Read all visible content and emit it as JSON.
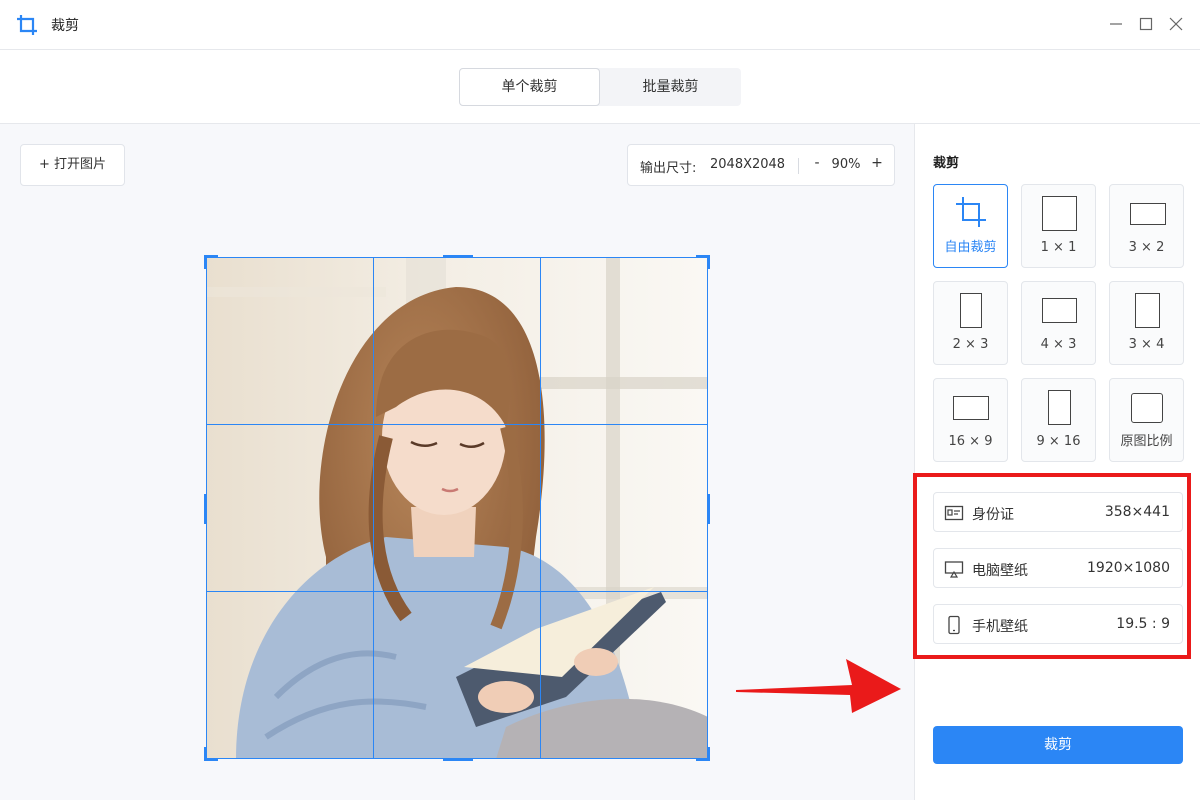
{
  "app": {
    "title": "裁剪",
    "icon": "crop-icon"
  },
  "window_controls": {
    "minimize": "minimize-icon",
    "maximize": "maximize-icon",
    "close": "close-icon"
  },
  "mode_tabs": [
    {
      "label": "单个裁剪",
      "active": true
    },
    {
      "label": "批量裁剪",
      "active": false
    }
  ],
  "toolbar": {
    "open_label": "+ 打开图片",
    "output_label": "输出尺寸:",
    "output_value": "2048X2048",
    "zoom_minus": "-",
    "zoom_value": "90%",
    "zoom_plus": "+"
  },
  "panel": {
    "title": "裁剪",
    "ratios": [
      {
        "label": "自由裁剪",
        "selected": true,
        "icon": "free-crop-icon"
      },
      {
        "label": "1 × 1",
        "selected": false
      },
      {
        "label": "3 × 2",
        "selected": false
      },
      {
        "label": "2 × 3",
        "selected": false
      },
      {
        "label": "4 × 3",
        "selected": false
      },
      {
        "label": "3 × 4",
        "selected": false
      },
      {
        "label": "16 × 9",
        "selected": false
      },
      {
        "label": "9 × 16",
        "selected": false
      },
      {
        "label": "原图比例",
        "selected": false
      }
    ],
    "presets": [
      {
        "name": "身份证",
        "value": "358×441",
        "icon": "id-card-icon"
      },
      {
        "name": "电脑壁纸",
        "value": "1920×1080",
        "icon": "monitor-icon"
      },
      {
        "name": "手机壁纸",
        "value": "19.5 : 9",
        "icon": "phone-icon"
      }
    ],
    "crop_button": "裁剪"
  },
  "colors": {
    "accent": "#2b86f5",
    "highlight": "#ea1a1a"
  }
}
